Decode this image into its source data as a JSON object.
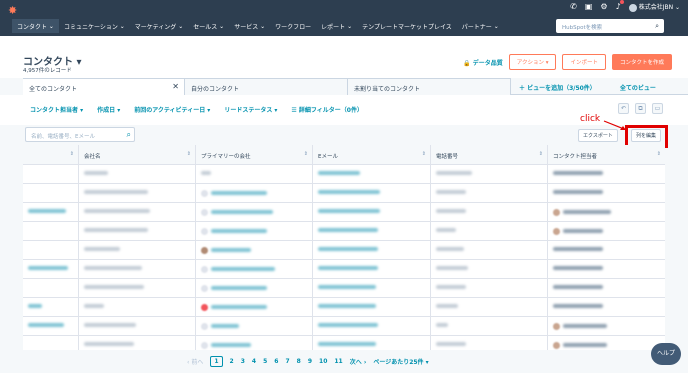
{
  "nav": {
    "logo": "✸",
    "menu": [
      "コンタクト",
      "コミュニケーション",
      "マーケティング",
      "セールス",
      "サービス",
      "ワークフロー",
      "レポート",
      "テンプレートマーケットプレイス",
      "パートナー"
    ],
    "search_placeholder": "HubSpotを検索",
    "account": "株式会社JBN"
  },
  "header": {
    "title": "コンタクト ▾",
    "record_count": "4,957件のレコード",
    "data_quality": "🔒 データ品質",
    "actions": "アクション ▾",
    "import": "インポート",
    "create": "コンタクトを作成"
  },
  "tabs": {
    "items": [
      "全てのコンタクト",
      "自分のコンタクト",
      "未割り当てのコンタクト"
    ],
    "add_view": "＋  ビューを追加（3/50件）",
    "all_views": "全てのビュー"
  },
  "filters": [
    "コンタクト担当者 ▾",
    "作成日 ▾",
    "前回のアクティビティー日 ▾",
    "リードステータス ▾",
    "☰  詳細フィルター（0件）"
  ],
  "toolbar": {
    "search_placeholder": "名前、電話番号、Eメール",
    "export": "エクスポート",
    "edit_columns": "列を編集",
    "click_label": "click"
  },
  "table": {
    "columns": [
      "",
      "会社名",
      "プライマリーの会社",
      "Eメール",
      "電話番号",
      "コンタクト担当者"
    ]
  },
  "pagination": {
    "prev": "前へ",
    "pages": [
      "1",
      "2",
      "3",
      "4",
      "5",
      "6",
      "7",
      "8",
      "9",
      "10",
      "11"
    ],
    "next": "次へ",
    "per_page": "ページあたり25件 ▾"
  },
  "help": "ヘルプ"
}
